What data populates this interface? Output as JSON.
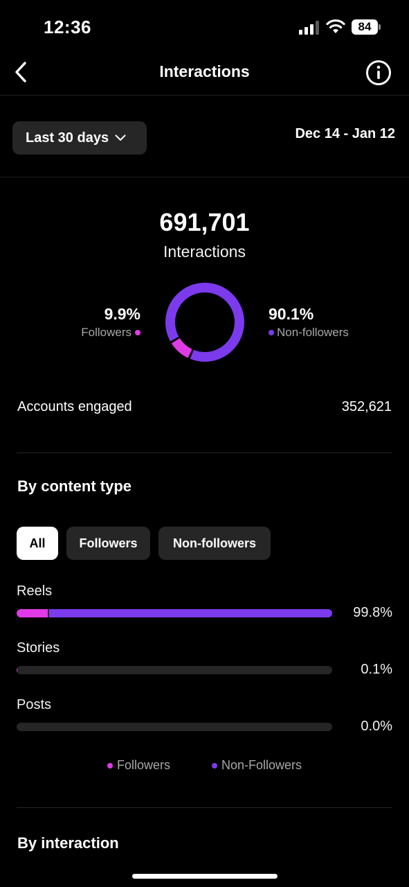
{
  "status_bar": {
    "time": "12:36",
    "battery": "84"
  },
  "header": {
    "title": "Interactions"
  },
  "filter": {
    "range_label": "Last 30 days",
    "date_range": "Dec 14 - Jan 12"
  },
  "summary": {
    "total": "691,701",
    "total_label": "Interactions",
    "followers_pct": "9.9%",
    "followers_label": "Followers",
    "nonfollowers_pct": "90.1%",
    "nonfollowers_label": "Non-followers",
    "followers_fraction": 0.099
  },
  "accounts_engaged": {
    "label": "Accounts engaged",
    "value": "352,621"
  },
  "content_type": {
    "title": "By content type",
    "chips": [
      {
        "label": "All",
        "active": true
      },
      {
        "label": "Followers",
        "active": false
      },
      {
        "label": "Non-followers",
        "active": false
      }
    ],
    "rows": [
      {
        "label": "Reels",
        "value": "99.8%",
        "followers_fraction": 0.098,
        "nonfollowers_fraction": 0.902,
        "total_fraction": 0.998
      },
      {
        "label": "Stories",
        "value": "0.1%",
        "followers_fraction": 0.003,
        "nonfollowers_fraction": 0.0,
        "total_fraction": 0.001
      },
      {
        "label": "Posts",
        "value": "0.0%",
        "followers_fraction": 0.0,
        "nonfollowers_fraction": 0.0,
        "total_fraction": 0.0
      }
    ],
    "legend": {
      "followers": "Followers",
      "nonfollowers": "Non-Followers"
    }
  },
  "by_interaction": {
    "title": "By interaction"
  },
  "colors": {
    "followers": "#e03ae6",
    "nonfollowers": "#7c3aed",
    "track": "#262626"
  },
  "icons": {
    "back": "chevron-left-icon",
    "info": "info-icon",
    "dropdown": "chevron-down-icon"
  }
}
